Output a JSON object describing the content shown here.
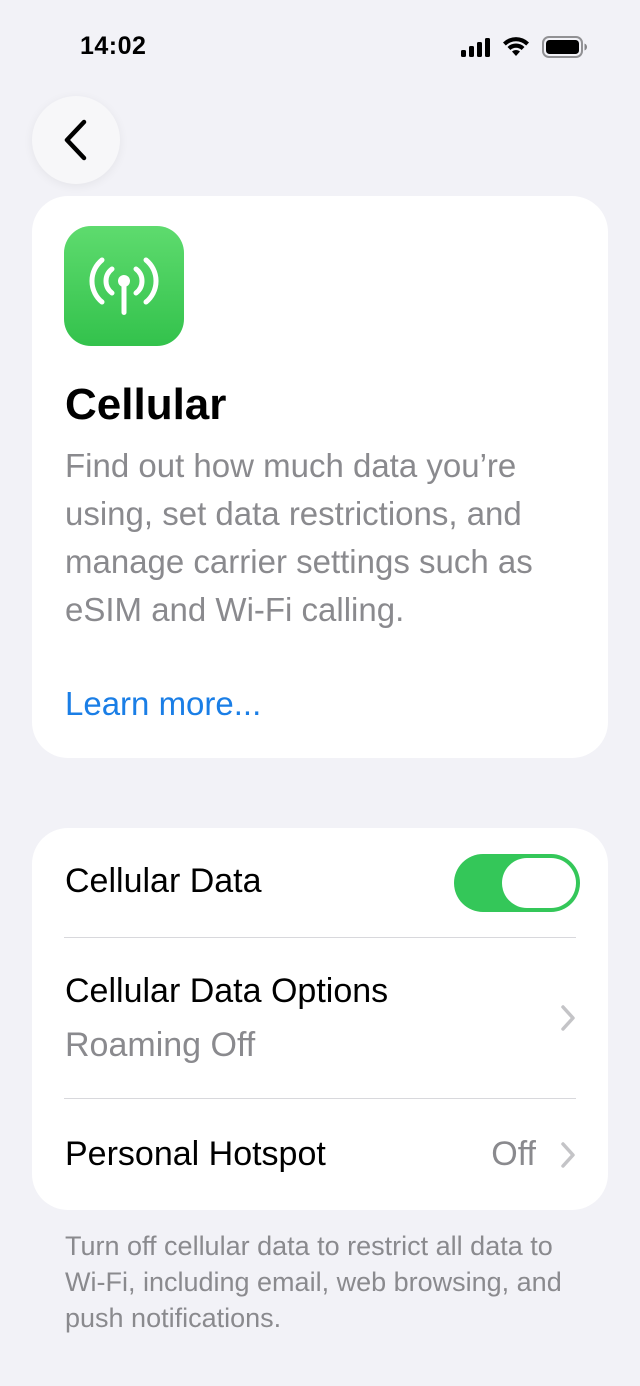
{
  "status_bar": {
    "time": "14:02"
  },
  "icons": {
    "back": "chevron-left-icon",
    "app": "cellular-antenna-icon",
    "chevron": "chevron-right-icon",
    "signal": "cellular-signal-icon",
    "wifi": "wifi-icon",
    "battery": "battery-icon"
  },
  "colors": {
    "accent_link": "#1a7ee6",
    "toggle_on": "#34c759",
    "app_icon_green": "#3dc853",
    "background": "#f2f2f7"
  },
  "info_card": {
    "title": "Cellular",
    "description": "Find out how much data you’re using, set data restrictions, and manage carrier settings such as eSIM and Wi-Fi calling.",
    "link": "Learn more..."
  },
  "settings": {
    "cellular_data": {
      "label": "Cellular Data",
      "enabled": true
    },
    "data_options": {
      "label": "Cellular Data Options",
      "subtitle": "Roaming Off"
    },
    "hotspot": {
      "label": "Personal Hotspot",
      "value": "Off"
    }
  },
  "footnote": "Turn off cellular data to restrict all data to Wi-Fi, including email, web browsing, and push notifications."
}
